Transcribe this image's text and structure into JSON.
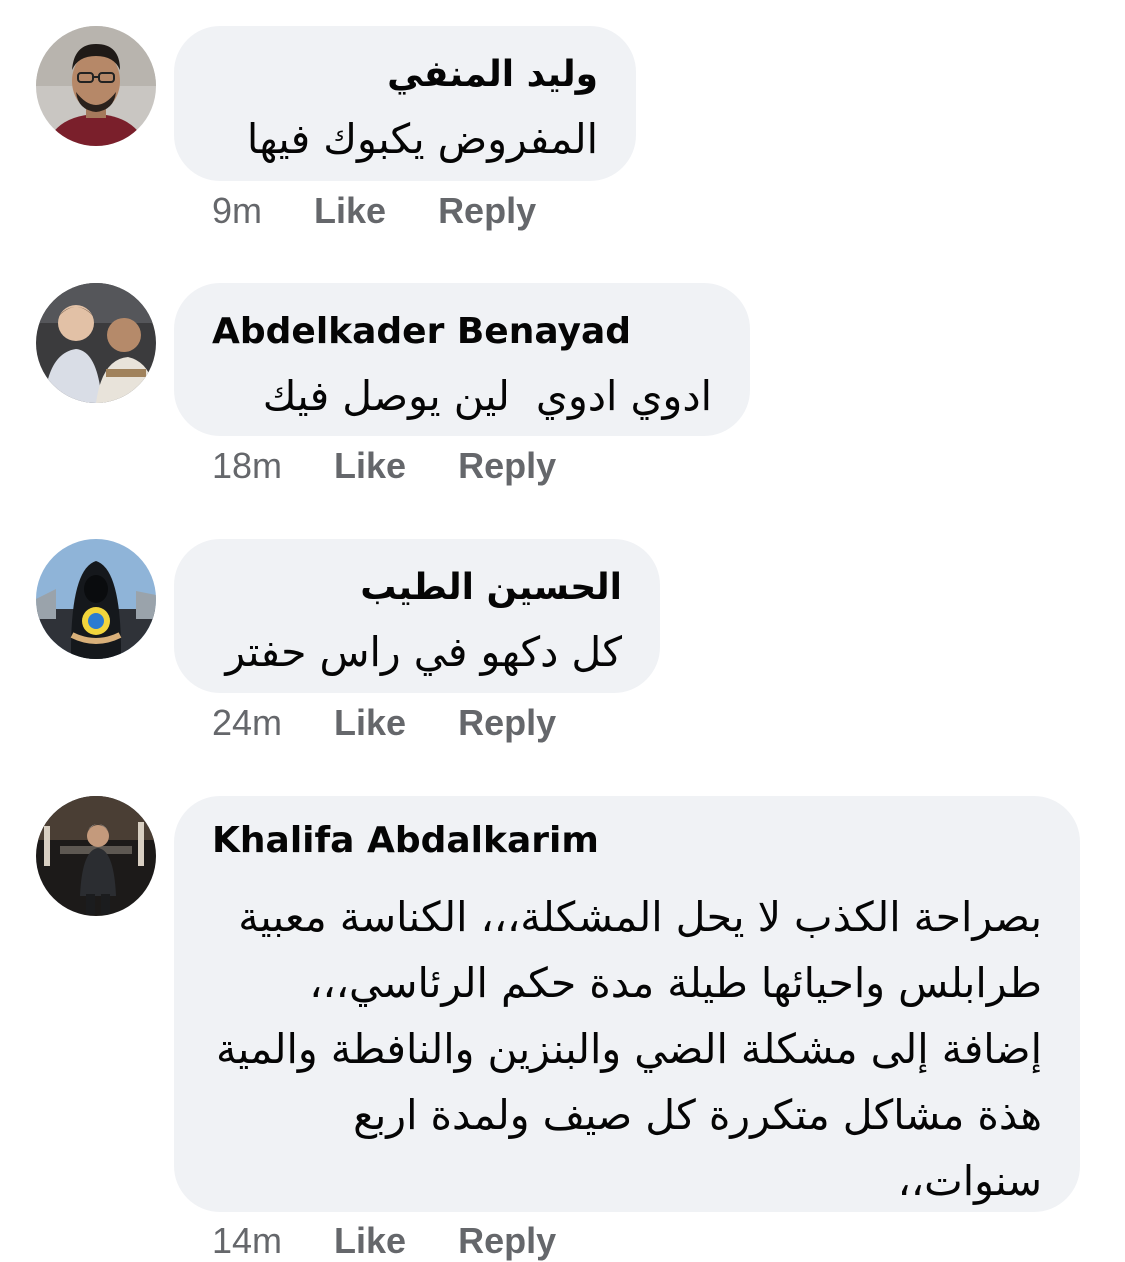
{
  "comments": [
    {
      "author": "وليد المنفي",
      "text": "المفروض يكبوك فيها",
      "time": "9m",
      "like_label": "Like",
      "reply_label": "Reply"
    },
    {
      "author": "Abdelkader Benayad",
      "text": "ادوي ادوي  لين يوصل فيك",
      "time": "18m",
      "like_label": "Like",
      "reply_label": "Reply"
    },
    {
      "author": "الحسين الطيب",
      "text": "كل دكهو في راس حفتر",
      "time": "24m",
      "like_label": "Like",
      "reply_label": "Reply"
    },
    {
      "author": "Khalifa Abdalkarim",
      "text": "بصراحة الكذب لا يحل المشكلة،،، الكناسة معبية طرابلس واحيائها طيلة مدة حكم الرئاسي،،، إضافة إلى مشكلة الضي والبنزين والنافطة والمية هذة مشاكل متكررة كل صيف ولمدة اربع سنوات،،",
      "time": "14m",
      "like_label": "Like",
      "reply_label": "Reply"
    }
  ]
}
